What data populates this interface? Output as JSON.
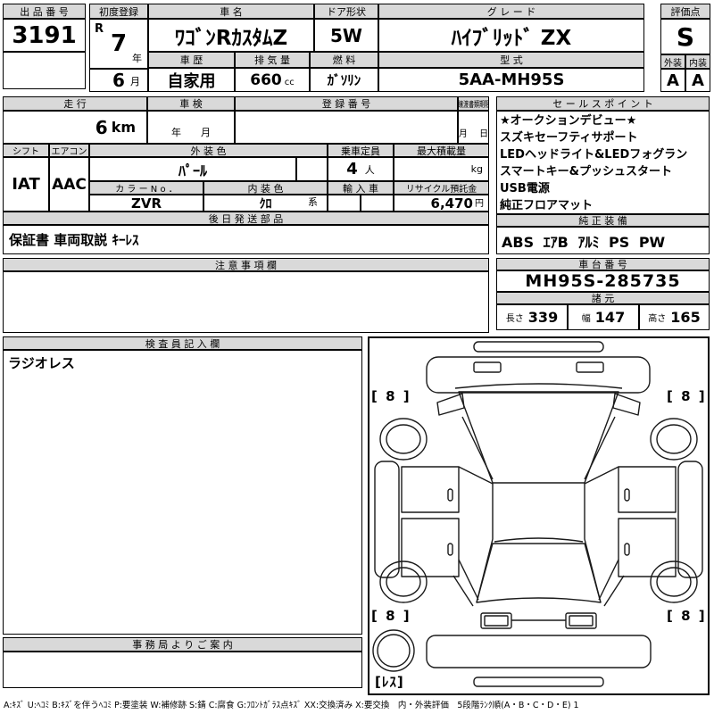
{
  "sheet": {
    "top": {
      "auction_no_label": "出 品 番 号",
      "auction_no": "3191",
      "first_reg_label": "初度登録",
      "first_reg_era": "R",
      "first_reg_year": "7",
      "first_reg_year_unit": "年",
      "first_reg_month": "6",
      "first_reg_month_unit": "月",
      "car_name_label": "車  名",
      "car_name": "ﾜｺﾞﾝRｶｽﾀﾑZ",
      "door_label": "ドア形状",
      "door": "5W",
      "grade_label": "グ レ ー ド",
      "grade": "ﾊｲﾌﾞﾘｯﾄﾞ ZX",
      "score_label": "評価点",
      "score": "S",
      "exterior_label": "外装",
      "interior_label": "内装",
      "exterior": "A",
      "interior": "A",
      "history_label": "車 歴",
      "history": "自家用",
      "displacement_label": "排 気 量",
      "displacement": "660",
      "displacement_unit": "cc",
      "fuel_label": "燃 料",
      "fuel": "ｶﾞｿﾘﾝ",
      "model_label": "型 式",
      "model": "5AA-MH95S"
    },
    "mid": {
      "mileage_label": "走 行",
      "mileage": "6",
      "mileage_unit": "km",
      "inspection_label": "車 検",
      "inspection_placeholder": "年　　月",
      "reg_no_label": "登 録 番 号",
      "deadline_label": "譲渡書類期限",
      "deadline_placeholder": "月　 日",
      "shift_label": "シフト",
      "shift": "IAT",
      "aircon_label": "エアコン",
      "aircon": "AAC",
      "ext_color_label": "外 装 色",
      "ext_color": "ﾊﾟｰﾙ",
      "capacity_label": "乗車定員",
      "capacity": "4",
      "capacity_unit": "人",
      "max_load_label": "最大積載量",
      "max_load_unit": "kg",
      "color_no_label": "カ ラ ー N o ．",
      "color_no": "ZVR",
      "int_color_label": "内 装 色",
      "int_color": "ｸﾛ",
      "int_color_suffix": "系",
      "import_label": "輸 入 車",
      "recycle_label": "リサイクル預託金",
      "recycle": "6,470",
      "recycle_unit": "円",
      "later_parts_label": "後 日 発 送 部 品",
      "later_parts": "保証書 車両取説 ｷｰﾚｽ",
      "notes_label": "注 意 事 項 欄"
    },
    "right": {
      "sales_label": "セ ー ル ス ポ イ ン ト",
      "sales_items": [
        "★オークションデビュー★",
        "スズキセーフティサポート",
        "LEDヘッドライト&LEDフォグラン",
        "スマートキー&プッシュスタート",
        "USB電源",
        "純正フロアマット"
      ],
      "equipment_label": "純 正 装 備",
      "equipment": "ABS ｴｱB ｱﾙﾐ PS PW",
      "chassis_label": "車 台 番 号",
      "chassis": "MH95S-285735",
      "specs_label": "諸 元",
      "length_label": "長さ",
      "length": "339",
      "width_label": "幅",
      "width": "147",
      "height_label": "高さ",
      "height": "165"
    },
    "bottom": {
      "inspector_label": "検 査 員 記 入 欄",
      "inspector_note": "ラジオレス",
      "office_label": "事 務 局 よ り ご 案 内"
    },
    "diagram": {
      "marks": [
        "[ 8 ]",
        "[ 8 ]",
        "[ 8 ]",
        "[ 8 ]"
      ],
      "spare_mark": "[ﾚｽ]"
    },
    "footer": "A:ｷｽﾞ U:ﾍｺﾐ B:ｷｽﾞを伴うﾍｺﾐ P:要塗装 W:補修跡 S:錆 C:腐食 G:ﾌﾛﾝﾄｶﾞﾗｽ点ｷｽﾞ XX:交換済み X:要交換　内・外装評価　5段階ﾗﾝｸ順(A・B・C・D・E) 1"
  }
}
